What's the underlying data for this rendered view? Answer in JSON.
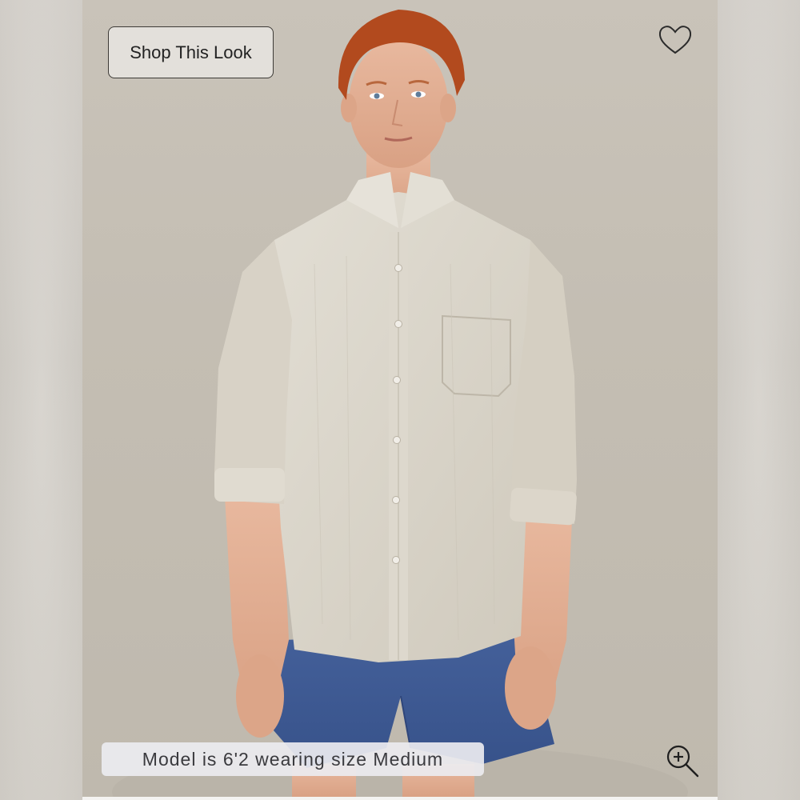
{
  "shop_button": {
    "label": "Shop This Look"
  },
  "favorite": {
    "icon": "heart-outline-icon"
  },
  "caption": {
    "text": "Model is 6'2 wearing size Medium"
  },
  "zoom": {
    "icon": "zoom-in-icon"
  },
  "colors": {
    "background": "#c6c0b6",
    "shirt": "#d9d4c9",
    "shorts": "#3e5a94",
    "hair": "#b24a1e",
    "skin": "#e2b096"
  }
}
